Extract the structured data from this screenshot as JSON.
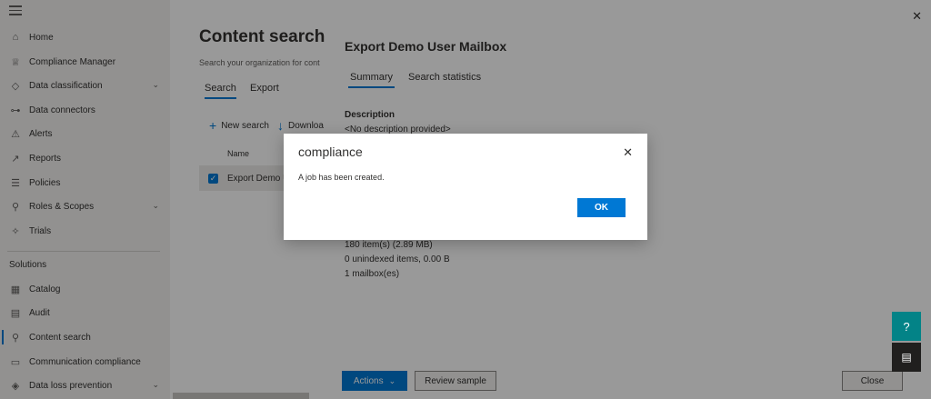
{
  "nav": {
    "items": [
      {
        "label": "Home",
        "icon": "home-icon",
        "glyph": "⌂"
      },
      {
        "label": "Compliance Manager",
        "icon": "trophy-icon",
        "glyph": "♕"
      },
      {
        "label": "Data classification",
        "icon": "tag-icon",
        "glyph": "◇",
        "chevron": true
      },
      {
        "label": "Data connectors",
        "icon": "connector-icon",
        "glyph": "⊶"
      },
      {
        "label": "Alerts",
        "icon": "alert-icon",
        "glyph": "⚠"
      },
      {
        "label": "Reports",
        "icon": "chart-icon",
        "glyph": "↗"
      },
      {
        "label": "Policies",
        "icon": "policies-icon",
        "glyph": "☰"
      },
      {
        "label": "Roles & Scopes",
        "icon": "roles-icon",
        "glyph": "⚲",
        "chevron": true
      },
      {
        "label": "Trials",
        "icon": "trials-icon",
        "glyph": "✧"
      }
    ],
    "section_label": "Solutions",
    "solutions": [
      {
        "label": "Catalog",
        "icon": "catalog-icon",
        "glyph": "▦"
      },
      {
        "label": "Audit",
        "icon": "audit-icon",
        "glyph": "▤"
      },
      {
        "label": "Content search",
        "icon": "search-icon",
        "glyph": "⚲"
      },
      {
        "label": "Communication compliance",
        "icon": "communication-icon",
        "glyph": "▭"
      },
      {
        "label": "Data loss prevention",
        "icon": "shield-icon",
        "glyph": "◈",
        "chevron": true
      }
    ]
  },
  "main": {
    "title": "Content search",
    "subtitle": "Search your organization for cont",
    "tabs": [
      "Search",
      "Export"
    ],
    "commands": [
      "New search",
      "Downloa"
    ],
    "column_name": "Name",
    "row_name": "Export Demo U"
  },
  "panel": {
    "title": "Export Demo User Mailbox",
    "tabs": [
      "Summary",
      "Search statistics"
    ],
    "description_label": "Description",
    "description_value": "<No description provided>",
    "stats": [
      "180 item(s) (2.89 MB)",
      "0 unindexed items, 0.00 B",
      "1 mailbox(es)"
    ],
    "actions_label": "Actions",
    "review_label": "Review sample",
    "close_label": "Close"
  },
  "dialog": {
    "title": "compliance",
    "message": "A job has been created.",
    "ok_label": "OK"
  },
  "colors": {
    "accent": "#0078d4",
    "teal": "#038387",
    "dark": "#201f1e"
  }
}
